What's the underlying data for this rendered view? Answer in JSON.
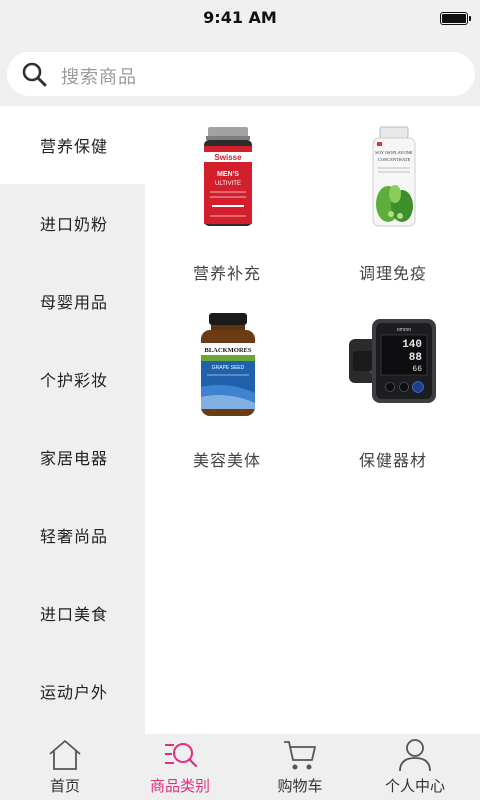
{
  "status_bar": {
    "time": "9:41 AM"
  },
  "search": {
    "placeholder": "搜索商品"
  },
  "sidebar": {
    "active_index": 0,
    "items": [
      {
        "label": "营养保健"
      },
      {
        "label": "进口奶粉"
      },
      {
        "label": "母婴用品"
      },
      {
        "label": "个护彩妆"
      },
      {
        "label": "家居电器"
      },
      {
        "label": "轻奢尚品"
      },
      {
        "label": "进口美食"
      },
      {
        "label": "运动户外"
      }
    ]
  },
  "products": [
    {
      "label": "营养补充",
      "image": "swisse-mens-multivitamin-bottle",
      "image_text": {
        "brand": "Swisse",
        "line1": "MEN'S",
        "line2": "ULTIVITE"
      }
    },
    {
      "label": "调理免疫",
      "image": "green-supplement-bottle",
      "image_text": {
        "line1": "SOY ISOFLAVONE",
        "line2": "CONCENTRATE"
      }
    },
    {
      "label": "美容美体",
      "image": "blackmores-grape-seed-bottle",
      "image_text": {
        "brand": "BLACKMORES",
        "line1": "GRAPE SEED"
      }
    },
    {
      "label": "保健器材",
      "image": "omron-blood-pressure-monitor",
      "image_text": {
        "brand": "omron",
        "sys": "140",
        "dia": "88",
        "pulse": "66"
      }
    }
  ],
  "tabbar": {
    "active_index": 1,
    "accent_color": "#e0307f",
    "items": [
      {
        "label": "首页",
        "icon": "home-icon"
      },
      {
        "label": "商品类别",
        "icon": "category-search-icon"
      },
      {
        "label": "购物车",
        "icon": "cart-icon"
      },
      {
        "label": "个人中心",
        "icon": "user-icon"
      }
    ]
  }
}
